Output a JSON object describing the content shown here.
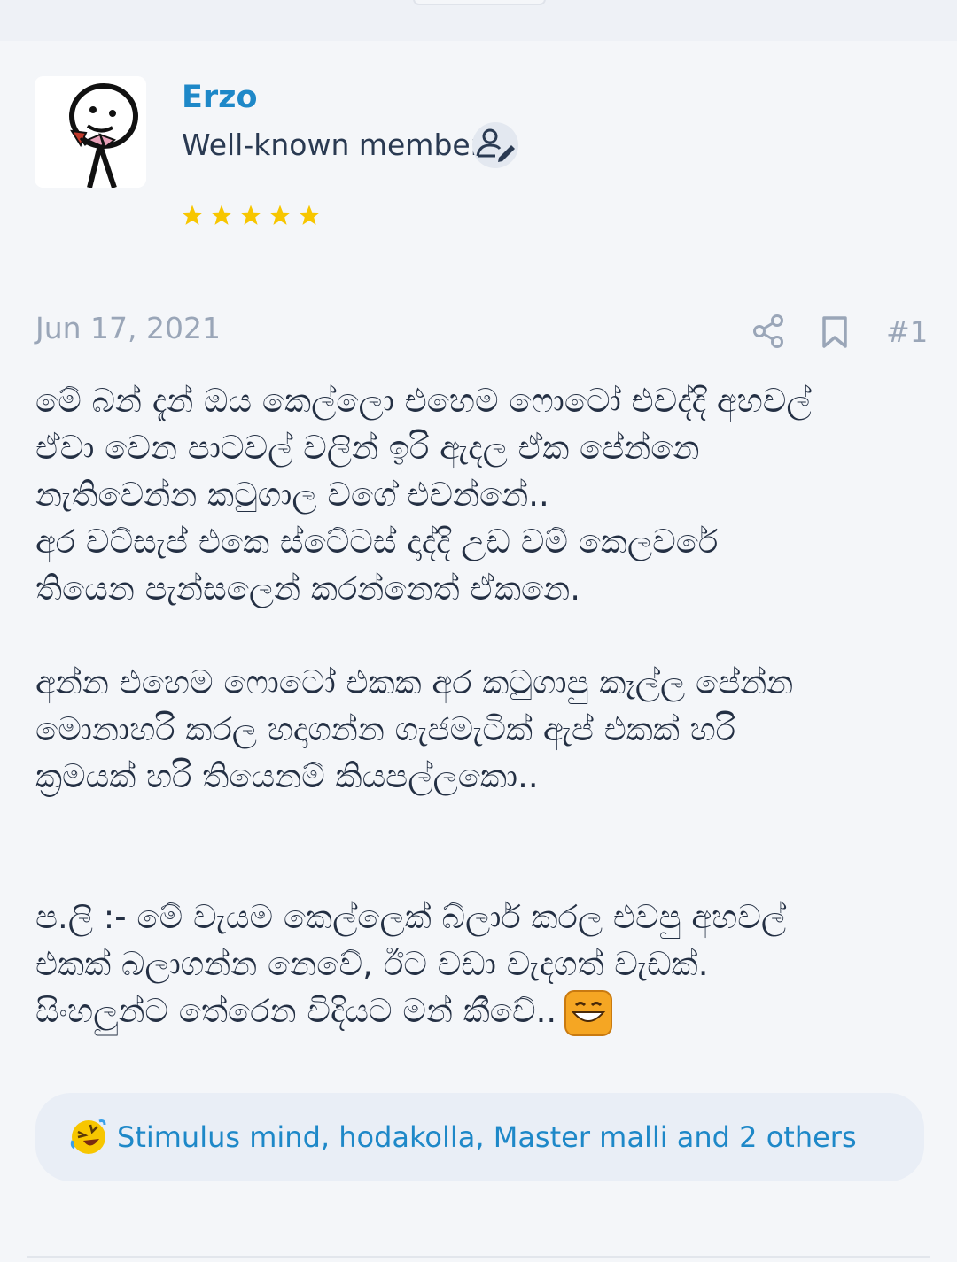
{
  "post": {
    "author": {
      "username": "Erzo",
      "title": "Well-known member",
      "stars": 5,
      "avatar_icon": "stick-figure-avatar"
    },
    "date": "Jun 17, 2021",
    "number": "#1",
    "body": {
      "paragraph1_lines": [
        "මේ බන් දැන් ඔය කෙල්ලො එහෙම ෆොටෝ එවද්දි අහවල්",
        "ඒවා වෙන පාටවල් වලින් ඉරි ඇදල ඒක පේන්නෙ",
        "නැතිවෙන්න කටුගාල වගේ එවන්නේ..",
        "අර වට්සැප් එකෙ ස්ටේටස් දාද්දි උඩ වම් කෙලවරේ",
        "තියෙන පැන්සලෙන් කරන්නෙත් ඒකනෙ."
      ],
      "paragraph2_lines": [
        "අන්න එහෙම ෆොටෝ එකක අර කටුගාපු කෑල්ල පේන්න",
        "මොනාහරි කරල හදාගන්න ගැජමැටික් ඇප් එකක් හරි",
        "ක්‍රමයක් හරි තියෙනම් කියපල්ලකො.."
      ],
      "paragraph3_lines": [
        "ප.ලි :- මේ වැයම කෙල්ලෙක් බ්ලාර් කරල එවපු අහවල්",
        "එකක් බලාගන්න නෙවේ, ඊට වඩා වැදගත් වැඩක්.",
        "සිංහලුන්ට තේරෙන විදියට මන් කීවේ.."
      ],
      "trailing_emoji": "grinning-face-emoji"
    },
    "reactions": {
      "emoji": "rolling-laughing-emoji",
      "text": "Stimulus mind, hodakolla, Master malli and 2 others"
    }
  },
  "colors": {
    "accent": "#1e88c8",
    "star": "#f7c600",
    "muted": "#9aa6b8",
    "background": "#f4f6f9"
  }
}
